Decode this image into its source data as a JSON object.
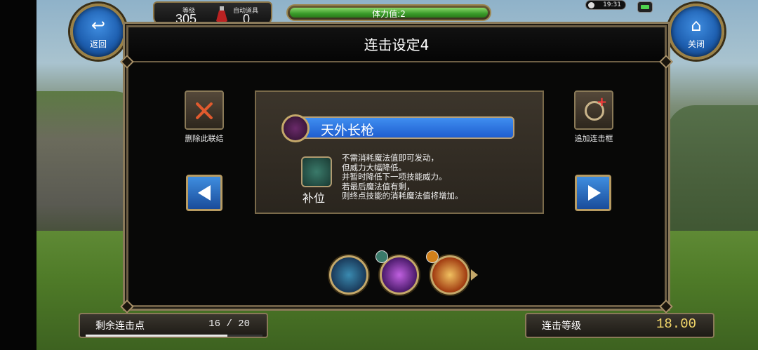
{
  "hud": {
    "level_label": "等级",
    "level_value": "305",
    "auto_item_label": "自动道具",
    "auto_item_value": "0",
    "stamina_text": "体力值:2",
    "stamina_fraction": 1.0,
    "clock": "19:31"
  },
  "buttons": {
    "back_label": "返回",
    "close_label": "关闭",
    "delete_link_label": "删除此联结",
    "add_frame_label": "追加连击框"
  },
  "dialog": {
    "title": "连击设定4"
  },
  "skill": {
    "name": "天外长枪",
    "sub_caption": "补位",
    "description": [
      "不需消耗魔法值即可发动，",
      "但威力大幅降低。",
      "并暂时降低下一项技能威力。",
      "若最后魔法值有剩，",
      "则终点技能的消耗魔法值将增加。"
    ]
  },
  "bottom": {
    "remaining_label": "剩余连击点",
    "remaining_value": "16 / 20",
    "remaining_fraction": 0.8,
    "level_label": "连击等级",
    "level_value": "18.00"
  },
  "colors": {
    "accent_gold": "#c4a86a",
    "button_blue": "#1f5ed0",
    "delete_red": "#e05a2e"
  }
}
